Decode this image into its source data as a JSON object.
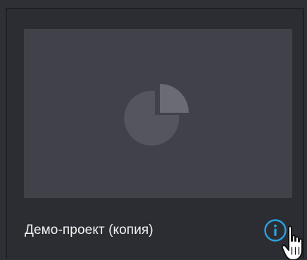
{
  "project_card": {
    "title": "Демо-проект (копия)",
    "preview_icon": "pie-chart-icon",
    "info_icon": "info-circle-icon",
    "pointer_icon": "hand-cursor-icon"
  },
  "colors": {
    "page_background": "#2f3036",
    "preview_background": "#414249",
    "pie_light": "#6a6b73",
    "pie_dark": "#55565d",
    "title_text": "#f2f2f2",
    "info_accent": "#2aa3df"
  }
}
